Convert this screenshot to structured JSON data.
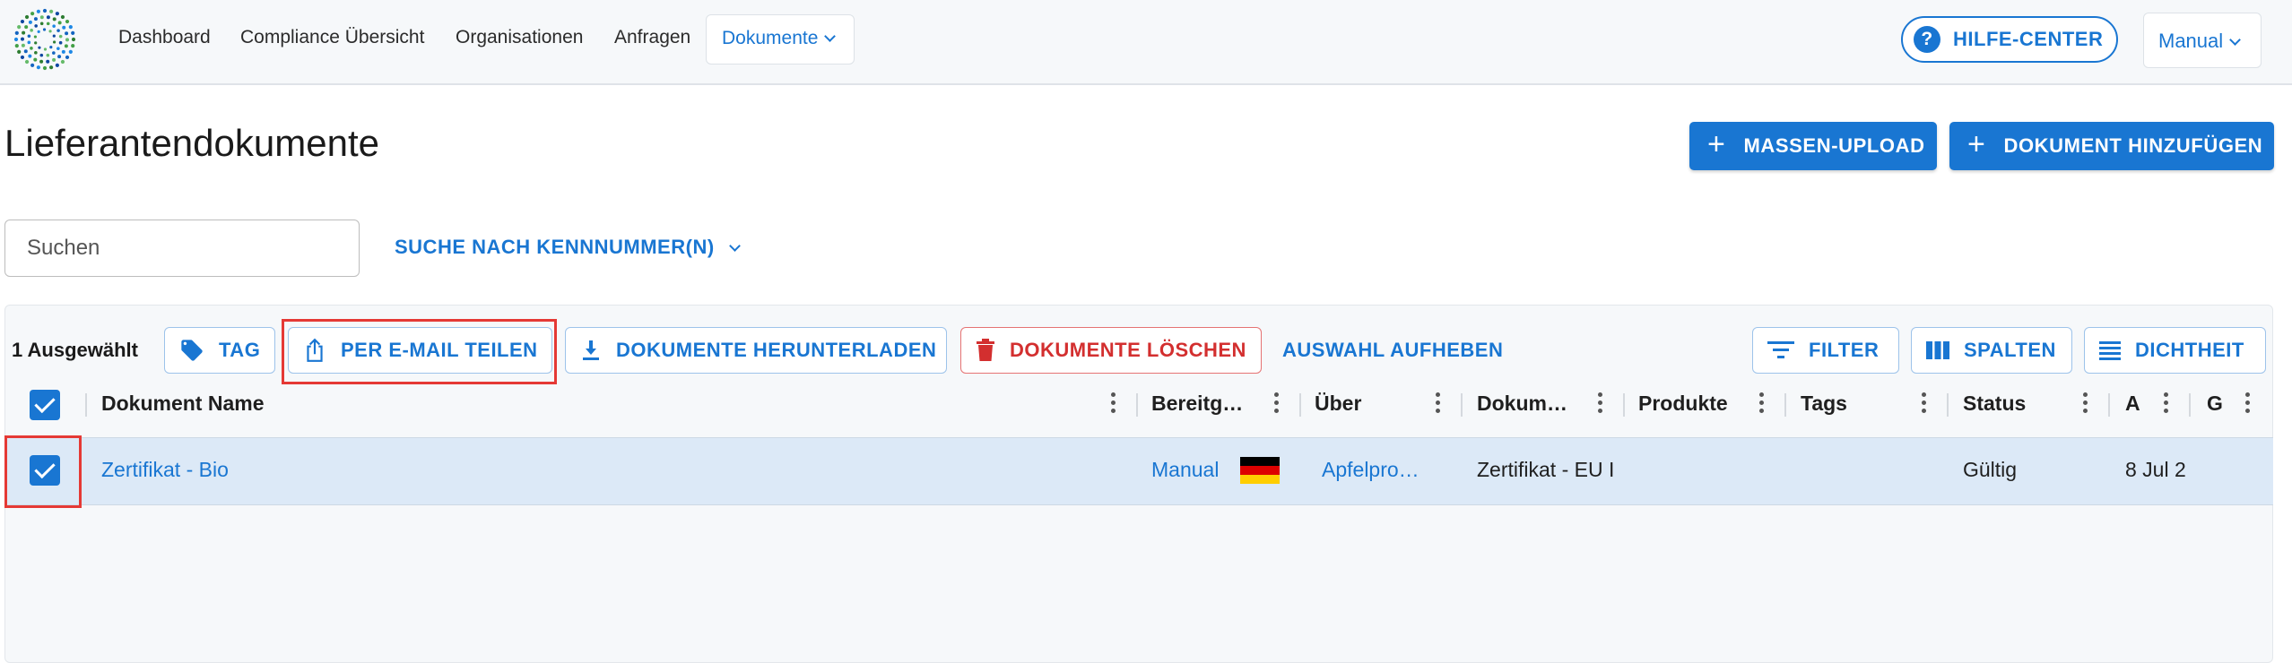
{
  "header": {
    "nav": [
      {
        "label": "Dashboard"
      },
      {
        "label": "Compliance Übersicht"
      },
      {
        "label": "Organisationen"
      },
      {
        "label": "Anfragen"
      }
    ],
    "active_dropdown": "Dokumente",
    "help_label": "HILFE-CENTER",
    "help_icon": "question-circle-icon",
    "user_label": "Manual"
  },
  "page": {
    "title": "Lieferantendokumente",
    "mass_upload_label": "MASSEN-UPLOAD",
    "add_document_label": "DOKUMENT HINZUFÜGEN"
  },
  "search": {
    "placeholder": "Suchen",
    "id_search_label": "SUCHE NACH KENNNUMMER(N)"
  },
  "toolbar": {
    "selected_count": "1 Ausgewählt",
    "tag_label": "TAG",
    "share_email_label": "PER E-MAIL TEILEN",
    "download_label": "DOKUMENTE HERUNTERLADEN",
    "delete_label": "DOKUMENTE LÖSCHEN",
    "clear_selection_label": "AUSWAHL AUFHEBEN",
    "filter_label": "FILTER",
    "columns_label": "SPALTEN",
    "density_label": "DICHTHEIT"
  },
  "table": {
    "columns": [
      "Dokument Name",
      "Bereitg…",
      "Über",
      "Dokum…",
      "Produkte",
      "Tags",
      "Status",
      "A",
      "G"
    ],
    "rows": [
      {
        "name": "Zertifikat - Bio",
        "provided_by": "Manual",
        "flag": "germany-flag-icon",
        "about": "Apfelpro…",
        "doc_type": "Zertifikat - EU I",
        "products": "",
        "tags": "",
        "status": "Gültig",
        "date": "8 Jul 2",
        "selected": true
      }
    ]
  },
  "colors": {
    "accent": "#1976d2",
    "danger": "#d32f2f",
    "highlight": "#e53935",
    "selected_row": "#dce9f7"
  }
}
